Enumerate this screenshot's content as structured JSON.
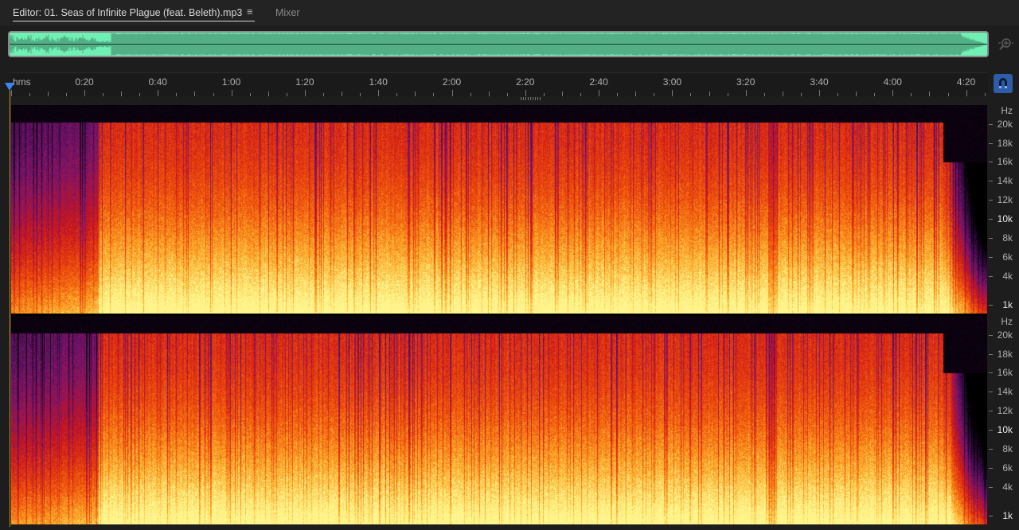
{
  "tabs": {
    "editor_label": "Editor: 01. Seas of Infinite Plague (feat. Beleth).mp3",
    "menu_icon": "≡",
    "mixer_label": "Mixer"
  },
  "ruler": {
    "unit": "hms",
    "labels": [
      "0:20",
      "0:40",
      "1:00",
      "1:20",
      "1:40",
      "2:00",
      "2:20",
      "2:40",
      "3:00",
      "3:20",
      "3:40",
      "4:00",
      "4:20"
    ]
  },
  "freq_axis": {
    "unit": "Hz",
    "labels": [
      "20k",
      "18k",
      "16k",
      "14k",
      "12k",
      "10k",
      "8k",
      "6k",
      "4k",
      "1k"
    ]
  },
  "icons": {
    "zoom": "zoom-in-icon",
    "snap": "magnet-icon"
  },
  "colors": {
    "overview_waveform": "#6ff0b4",
    "playhead": "#3b86f0",
    "accent_button": "#2d5da8"
  }
}
